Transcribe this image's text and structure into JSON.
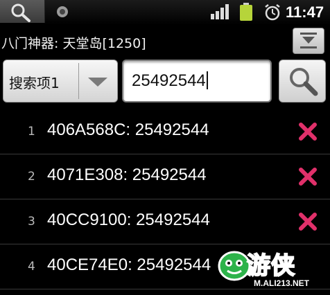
{
  "status_bar": {
    "time": "11:47",
    "icons": [
      "search-icon",
      "notification-icon",
      "signal-icon",
      "battery-icon",
      "alarm-icon"
    ],
    "battery_color": "#b6d43a"
  },
  "title_bar": {
    "title": "八门神器: 天堂岛[1250]",
    "button_icon": "collapse-icon"
  },
  "search": {
    "type_selected": "搜索项1",
    "value": "25492544"
  },
  "results": [
    {
      "index": "1",
      "text": "406A568C: 25492544"
    },
    {
      "index": "2",
      "text": "4071E308: 25492544"
    },
    {
      "index": "3",
      "text": "40CC9100: 25492544"
    },
    {
      "index": "4",
      "text": "40CE74E0: 25492544"
    }
  ],
  "watermark": {
    "logo_text": "游侠",
    "url": "M.ALI213.NET",
    "color": "#2db34a"
  },
  "colors": {
    "delete": "#e0306a"
  }
}
